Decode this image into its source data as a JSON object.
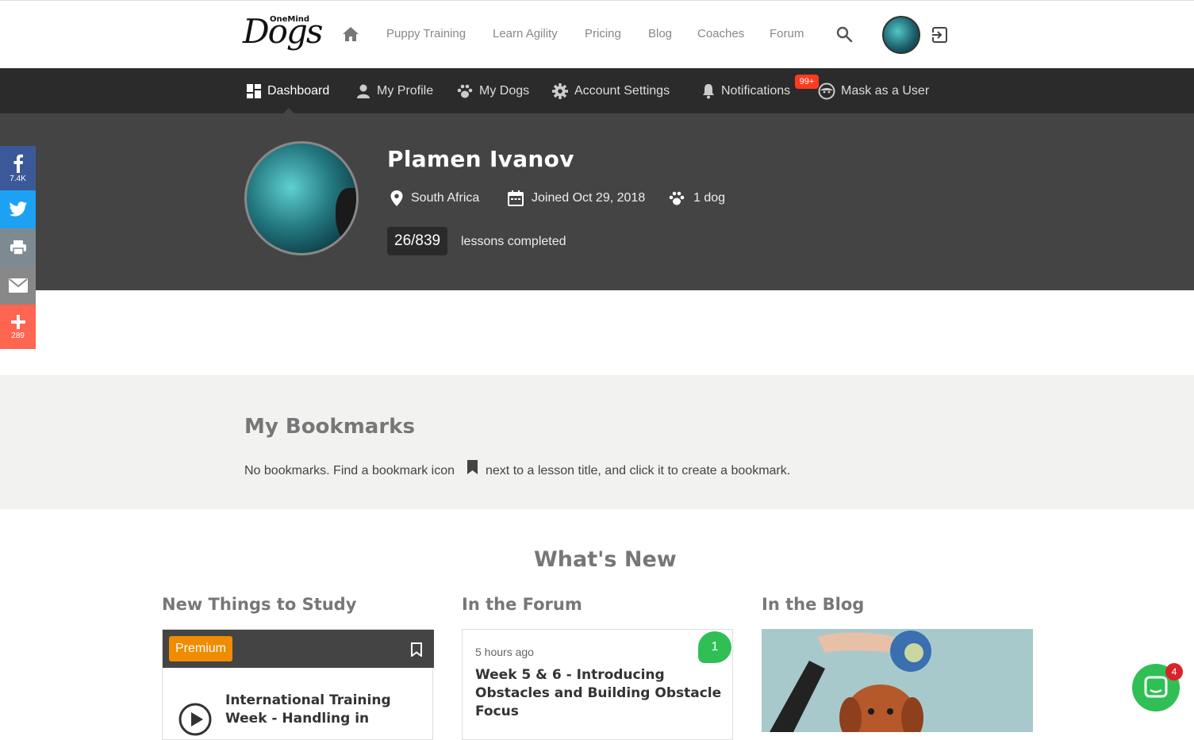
{
  "header": {
    "logo_small": "OneMind",
    "logo_big": "Dogs",
    "nav": [
      "Puppy Training",
      "Learn Agility",
      "Pricing",
      "Blog",
      "Coaches",
      "Forum"
    ]
  },
  "dashnav": {
    "items": [
      "Dashboard",
      "My Profile",
      "My Dogs",
      "Account Settings",
      "Notifications",
      "Mask as a User"
    ],
    "notifications_badge": "99+"
  },
  "profile": {
    "name": "Plamen Ivanov",
    "country": "South Africa",
    "joined": "Joined Oct 29, 2018",
    "dogs": "1 dog",
    "lessons_count": "26/839",
    "lessons_label": "lessons completed"
  },
  "share": {
    "facebook_count": "7.4K",
    "more_count": "289"
  },
  "bookmarks": {
    "title": "My Bookmarks",
    "text_before": "No bookmarks. Find a bookmark icon",
    "text_after": "next to a lesson title, and click it to create a bookmark."
  },
  "whats_new": {
    "title": "What's New",
    "columns": [
      "New Things to Study",
      "In the Forum",
      "In the Blog"
    ],
    "study_card": {
      "badge": "Premium",
      "title_line1": "International Training",
      "title_line2": "Week - Handling in"
    },
    "forum_card": {
      "time": "5 hours ago",
      "replies": "1",
      "title_line1": "Week 5 & 6 - Introducing",
      "title_line2": "Obstacles and Building Obstacle",
      "title_line3": "Focus"
    }
  },
  "chat": {
    "badge": "4"
  },
  "colors": {
    "dark_nav": "#2b2b2b",
    "hero": "#444444",
    "facebook": "#3b5998",
    "twitter": "#1da1f2",
    "print": "#7d8a92",
    "email": "#888888",
    "more": "#ff6550",
    "premium": "#f08c00",
    "forum_badge": "#2fbf55"
  }
}
